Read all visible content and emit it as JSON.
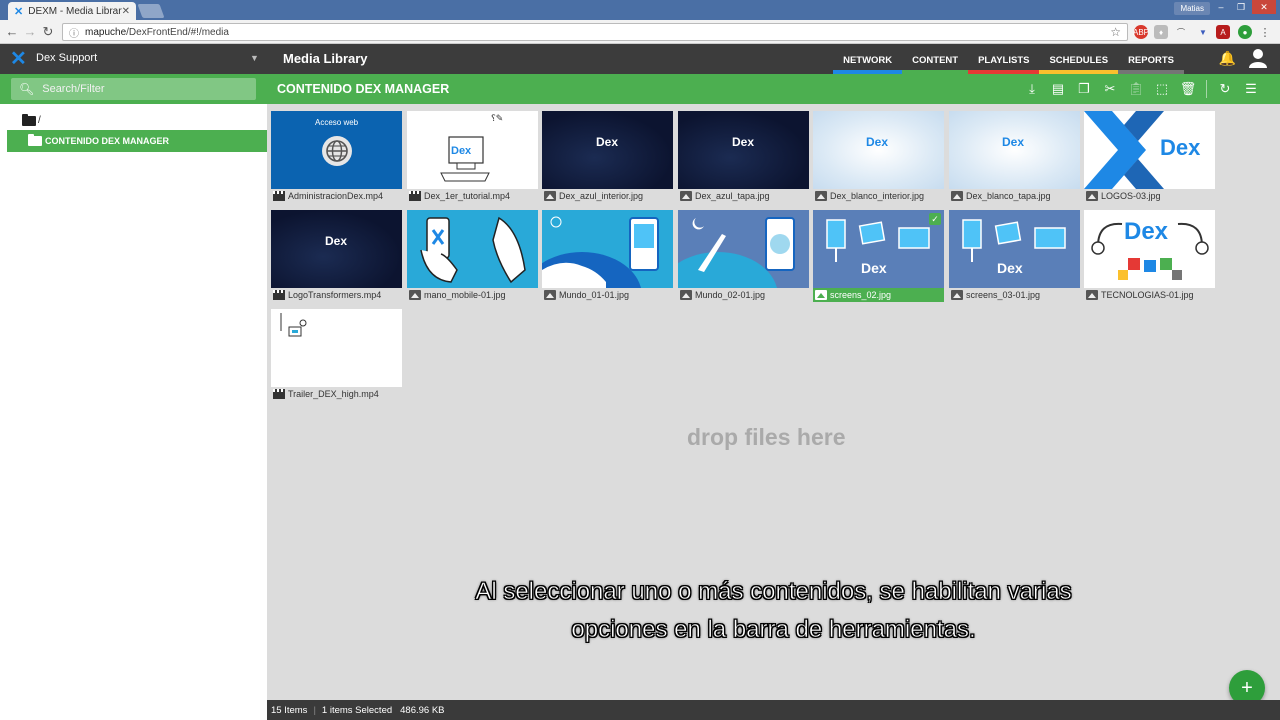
{
  "browser": {
    "tab_title": "DEXM - Media Library",
    "url_host": "mapuche",
    "url_path": "/DexFrontEnd/#!/media",
    "window_user": "Matias"
  },
  "app": {
    "account": "Dex Support",
    "title": "Media Library",
    "nav": [
      {
        "label": "NETWORK",
        "color": "#1e88e5"
      },
      {
        "label": "CONTENT",
        "color": "#4caf50"
      },
      {
        "label": "PLAYLISTS",
        "color": "#e53935"
      },
      {
        "label": "SCHEDULES",
        "color": "#fbc02d"
      },
      {
        "label": "REPORTS",
        "color": "#757575"
      }
    ]
  },
  "toolbar": {
    "search_placeholder": "Search/Filter",
    "folder_title": "CONTENIDO DEX MANAGER"
  },
  "sidebar": {
    "root_label": "/",
    "selected_folder": "CONTENIDO DEX MANAGER"
  },
  "media": [
    {
      "name": "AdministracionDex.mp4",
      "type": "video",
      "thumb": "blue",
      "thumb_text": "Acceso web"
    },
    {
      "name": "Dex_1er_tutorial.mp4",
      "type": "video",
      "thumb": "white",
      "thumb_text": "Dex"
    },
    {
      "name": "Dex_azul_interior.jpg",
      "type": "image",
      "thumb": "navy",
      "thumb_text": "Dex"
    },
    {
      "name": "Dex_azul_tapa.jpg",
      "type": "image",
      "thumb": "navy",
      "thumb_text": "Dex"
    },
    {
      "name": "Dex_blanco_interior.jpg",
      "type": "image",
      "thumb": "pale",
      "thumb_text": "Dex"
    },
    {
      "name": "Dex_blanco_tapa.jpg",
      "type": "image",
      "thumb": "pale",
      "thumb_text": "Dex"
    },
    {
      "name": "LOGOS-03.jpg",
      "type": "image",
      "thumb": "logo",
      "thumb_text": "Dex"
    },
    {
      "name": "LogoTransformers.mp4",
      "type": "video",
      "thumb": "navy",
      "thumb_text": "Dex"
    },
    {
      "name": "mano_mobile-01.jpg",
      "type": "image",
      "thumb": "cyan",
      "thumb_text": ""
    },
    {
      "name": "Mundo_01-01.jpg",
      "type": "image",
      "thumb": "cyan",
      "thumb_text": ""
    },
    {
      "name": "Mundo_02-01.jpg",
      "type": "image",
      "thumb": "slate",
      "thumb_text": ""
    },
    {
      "name": "screens_02.jpg",
      "type": "image",
      "thumb": "slate",
      "thumb_text": "Dex",
      "selected": true
    },
    {
      "name": "screens_03-01.jpg",
      "type": "image",
      "thumb": "slate",
      "thumb_text": "Dex"
    },
    {
      "name": "TECNOLOGIAS-01.jpg",
      "type": "image",
      "thumb": "white",
      "thumb_text": "Dex"
    },
    {
      "name": "Trailer_DEX_high.mp4",
      "type": "video",
      "thumb": "white",
      "thumb_text": ""
    }
  ],
  "dropzone": "drop files here",
  "subtitle": {
    "line1": "Al seleccionar uno o más contenidos, se habilitan varias",
    "line2": "opciones en la barra de herramientas."
  },
  "status": {
    "items": "15 Items",
    "selected": "1 items Selected",
    "size": "486.96 KB"
  },
  "fab_label": "+"
}
